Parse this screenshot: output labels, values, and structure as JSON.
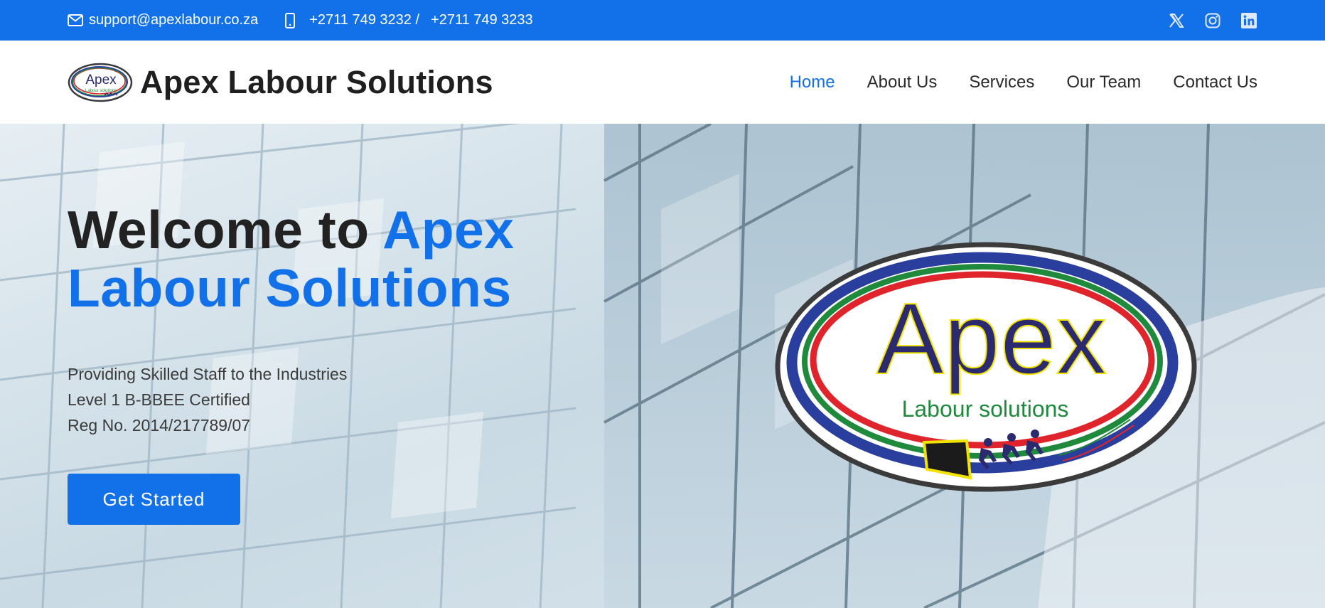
{
  "topbar": {
    "email": "support@apexlabour.co.za",
    "phone1": "+2711 749 3232 /",
    "phone2": "+2711 749 3233",
    "social": [
      "x-twitter",
      "instagram",
      "linkedin"
    ]
  },
  "header": {
    "brand_name": "Apex Labour Solutions",
    "nav": [
      "Home",
      "About Us",
      "Services",
      "Our Team",
      "Contact Us"
    ],
    "active": "Home"
  },
  "hero": {
    "title_plain": "Welcome to ",
    "title_accent_1": "Apex",
    "title_accent_2": "Labour Solutions",
    "line1": "Providing Skilled Staff to the Industries",
    "line2": "Level 1 B-BBEE Certified",
    "line3": "Reg No. 2014/217789/07",
    "cta": "Get Started"
  },
  "logo": {
    "wordmark": "Apex",
    "tagline": "Labour solutions"
  },
  "colors": {
    "accent": "#1271e8",
    "dark_text": "#1f1f1f",
    "logo_navy": "#2b2a6e",
    "logo_red": "#e0242b",
    "logo_green": "#1f8a3c",
    "logo_blue": "#2a3f9d",
    "logo_yellow": "#f2e200"
  }
}
